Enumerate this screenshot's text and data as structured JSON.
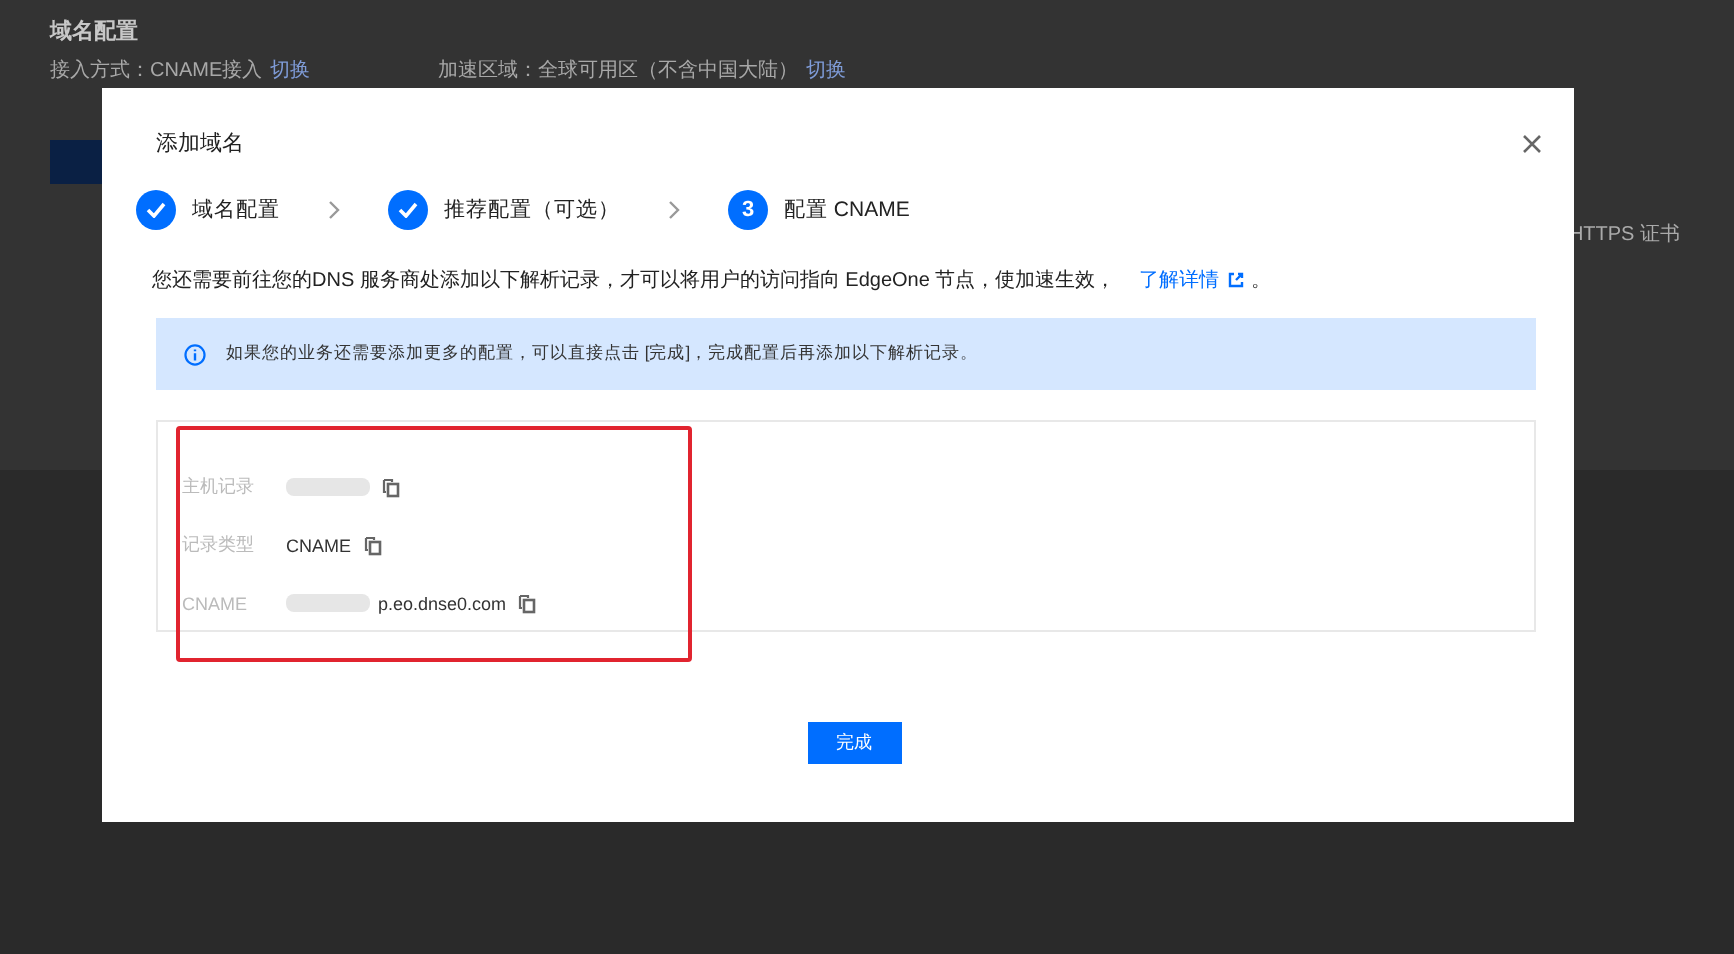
{
  "page": {
    "title": "域名配置",
    "access_label": "接入方式：CNAME接入",
    "access_link": "切换",
    "region_label": "加速区域：全球可用区（不含中国大陆）",
    "region_link": "切换",
    "column_label": "HTTPS 证书"
  },
  "dialog": {
    "title": "添加域名",
    "steps": [
      {
        "label": "域名配置",
        "done": true
      },
      {
        "label": "推荐配置（可选）",
        "done": true
      },
      {
        "label": "配置 CNAME",
        "done": false,
        "number": "3"
      }
    ],
    "description": "您还需要前往您的DNS 服务商处添加以下解析记录，才可以将用户的访问指向 EdgeOne 节点，使加速生效，",
    "learn_more": "了解详情",
    "description_end": "。",
    "notice": "如果您的业务还需要添加更多的配置，可以直接点击 [完成]，完成配置后再添加以下解析记录。",
    "records": [
      {
        "label": "主机记录",
        "redacted": true
      },
      {
        "label": "记录类型",
        "value": "CNAME",
        "redacted": false
      },
      {
        "label": "CNAME",
        "value": "p.eo.dnse0.com",
        "redacted": true
      }
    ],
    "confirm_button": "完成"
  }
}
